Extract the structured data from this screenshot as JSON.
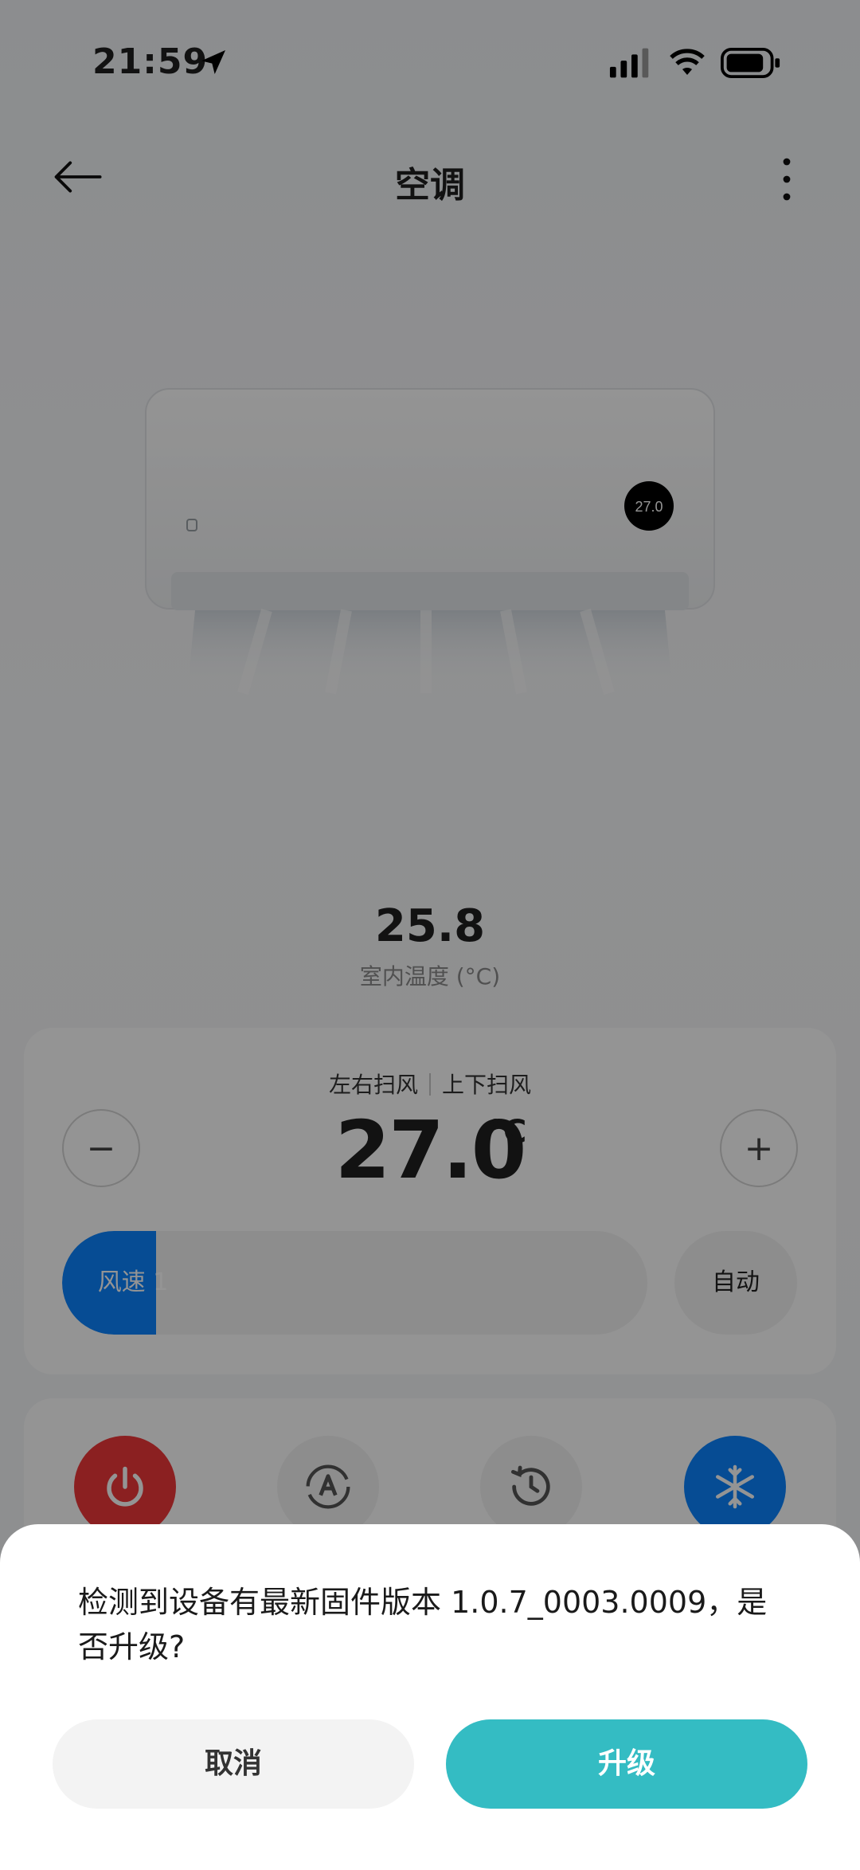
{
  "status_bar": {
    "time": "21:59",
    "icons": [
      "location-arrow-icon",
      "cellular-signal-icon",
      "wifi-icon",
      "battery-icon"
    ]
  },
  "nav": {
    "title": "空调",
    "back_icon": "arrow-left-icon",
    "more_icon": "more-vertical-icon"
  },
  "device_display": {
    "temp": "27.0"
  },
  "indoor": {
    "value": "25.8",
    "label": "室内温度 (°C)"
  },
  "control": {
    "swing_lr": "左右扫风",
    "swing_ud": "上下扫风",
    "set_temp": "27.0",
    "unit": "°C",
    "minus": "−",
    "plus": "+",
    "fan_speed_label": "风速 1",
    "fan_speed_fraction": 0.16,
    "auto_label": "自动"
  },
  "modes": [
    {
      "name": "power",
      "icon": "power-icon",
      "color": "#f0373a"
    },
    {
      "name": "auto",
      "icon": "auto-mode-icon",
      "color": "#f3f3f3"
    },
    {
      "name": "timer",
      "icon": "timer-icon",
      "color": "#f3f3f3"
    },
    {
      "name": "cool",
      "icon": "snowflake-icon",
      "color": "#0b84ff"
    }
  ],
  "dialog": {
    "message": "检测到设备有最新固件版本 1.0.7_0003.0009，是否升级?",
    "cancel": "取消",
    "confirm": "升级"
  },
  "colors": {
    "accent": "#0b84ff",
    "power": "#f0373a",
    "confirm": "#34bcc3"
  }
}
